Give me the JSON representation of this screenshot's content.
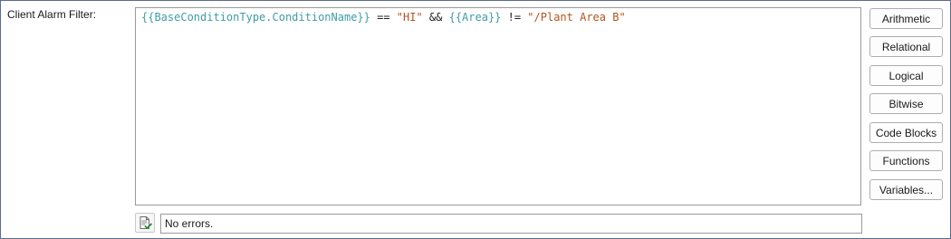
{
  "filter": {
    "label": "Client Alarm Filter:",
    "expression_tokens": [
      {
        "text": "{{BaseConditionType.ConditionName}}",
        "kind": "var"
      },
      {
        "text": " == ",
        "kind": "op"
      },
      {
        "text": "\"HI\"",
        "kind": "str"
      },
      {
        "text": " && ",
        "kind": "op"
      },
      {
        "text": "{{Area}}",
        "kind": "var"
      },
      {
        "text": " != ",
        "kind": "op"
      },
      {
        "text": "\"/Plant Area B\"",
        "kind": "str"
      }
    ]
  },
  "buttons": {
    "arithmetic": "Arithmetic",
    "relational": "Relational",
    "logical": "Logical",
    "bitwise": "Bitwise",
    "code_blocks": "Code Blocks",
    "functions": "Functions",
    "variables": "Variables..."
  },
  "status": {
    "icon": "validate-check-icon",
    "message": "No errors."
  },
  "colors": {
    "variable": "#3f9ca6",
    "string": "#b0541e",
    "operator": "#202020",
    "border": "#5a6b8c"
  }
}
